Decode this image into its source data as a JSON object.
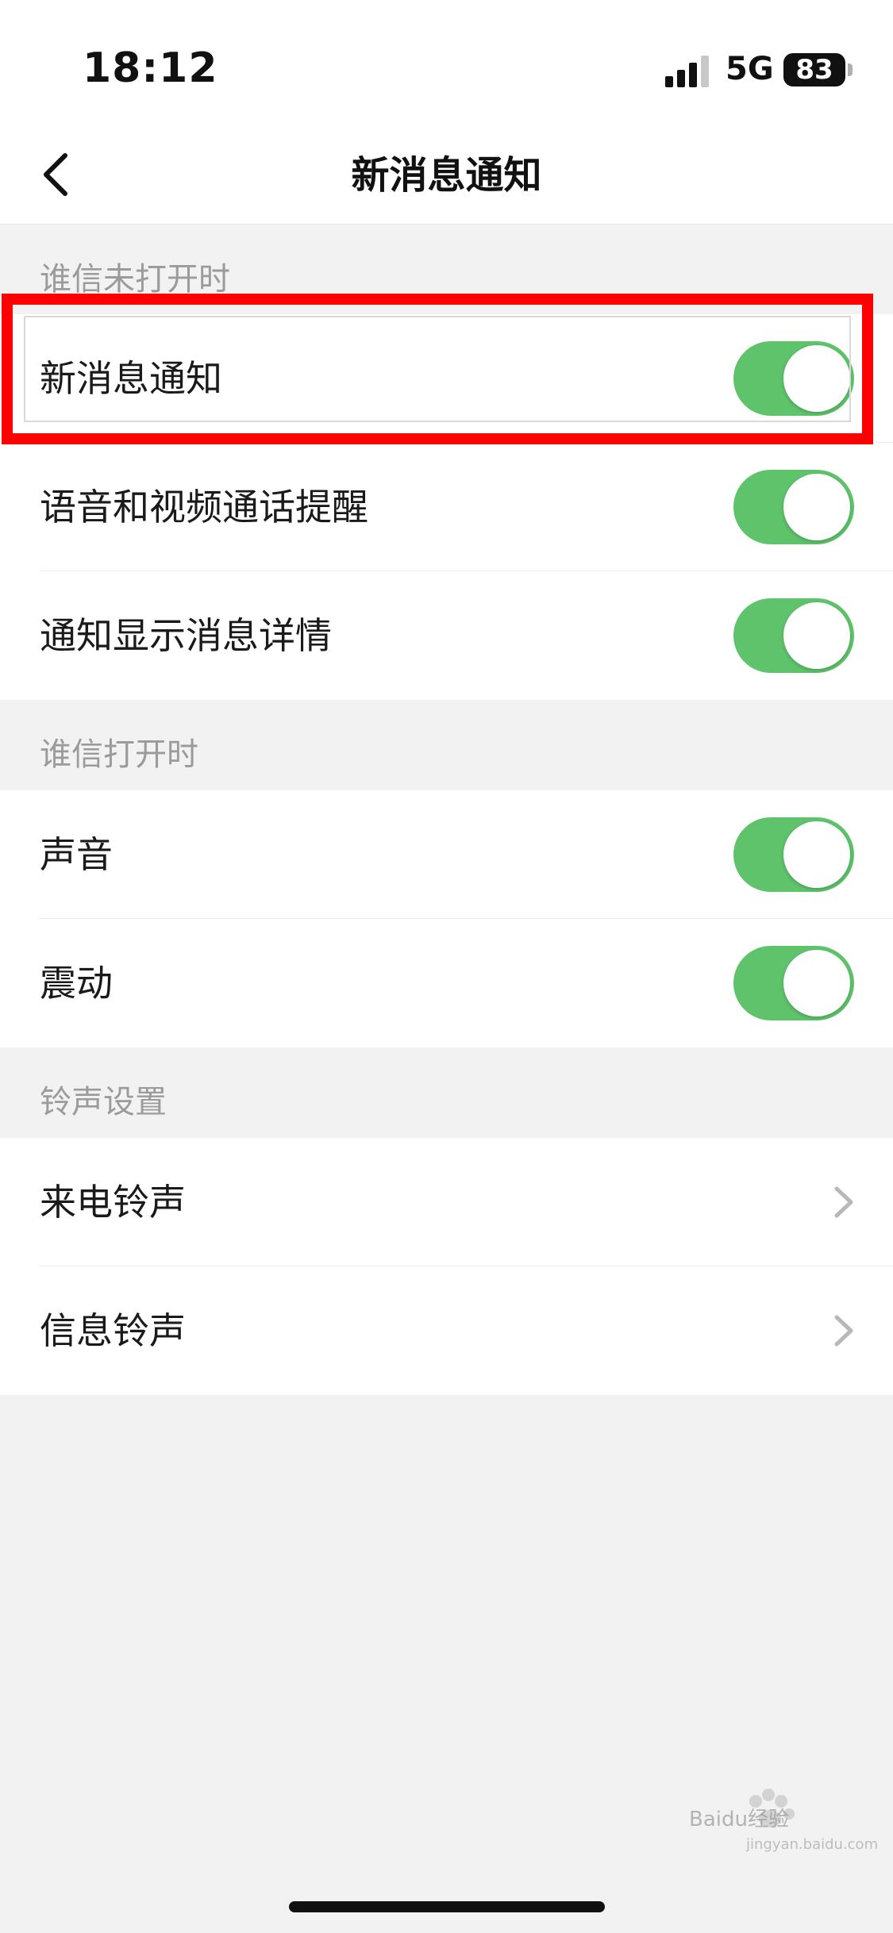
{
  "status_bar": {
    "time": "18:12",
    "network": "5G",
    "battery": "83"
  },
  "nav": {
    "title": "新消息通知"
  },
  "sections": [
    {
      "header": "谁信未打开时",
      "items": [
        {
          "label": "新消息通知",
          "on": true
        },
        {
          "label": "语音和视频通话提醒",
          "on": true
        },
        {
          "label": "通知显示消息详情",
          "on": true
        }
      ]
    },
    {
      "header": "谁信打开时",
      "items": [
        {
          "label": "声音",
          "on": true
        },
        {
          "label": "震动",
          "on": true
        }
      ]
    },
    {
      "header": "铃声设置",
      "items": [
        {
          "label": "来电铃声"
        },
        {
          "label": "信息铃声"
        }
      ]
    }
  ],
  "watermark": {
    "brand": "Baidu经验",
    "domain": "jingyan.baidu.com"
  },
  "colors": {
    "toggle_on": "#5ec36b",
    "highlight": "#ff0000",
    "background": "#f2f2f2"
  }
}
